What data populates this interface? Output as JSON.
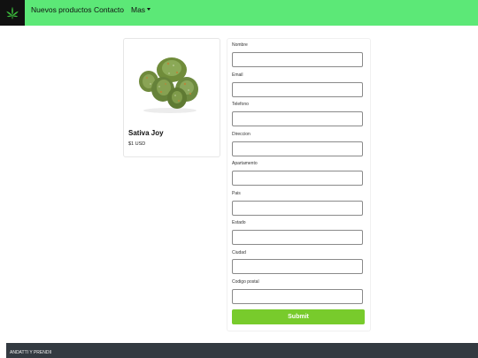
{
  "navbar": {
    "logo_icon": "cannabis-leaf-icon",
    "items": [
      {
        "label": "Nuevos productos"
      },
      {
        "label": "Contacto"
      },
      {
        "label": "Mas"
      }
    ]
  },
  "product": {
    "name": "Sativa Joy",
    "price": "$1 USD",
    "image_icon": "cannabis-buds-image"
  },
  "form": {
    "fields": [
      {
        "label": "Nombre",
        "value": ""
      },
      {
        "label": "Email",
        "value": ""
      },
      {
        "label": "Telefono",
        "value": ""
      },
      {
        "label": "Direccion",
        "value": ""
      },
      {
        "label": "Apartamento",
        "value": ""
      },
      {
        "label": "Pais",
        "value": ""
      },
      {
        "label": "Estado",
        "value": ""
      },
      {
        "label": "Ciudad",
        "value": ""
      },
      {
        "label": "Codigo postal",
        "value": ""
      }
    ],
    "submit_label": "Submit"
  },
  "footer": {
    "text": "ANDATTI Y PRENDII"
  },
  "colors": {
    "navbar": "#5ce877",
    "submit": "#78cb2c",
    "footer": "#333a41"
  }
}
